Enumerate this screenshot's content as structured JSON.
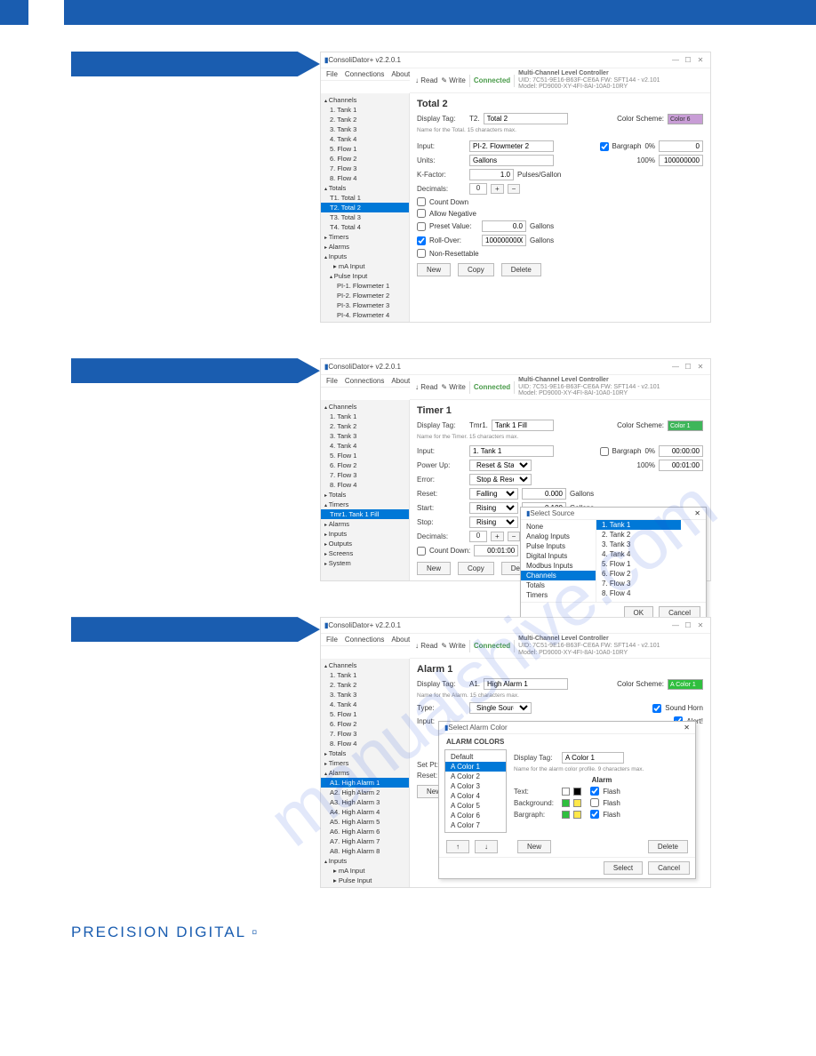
{
  "brand_footer": "PRECISION DIGITAL",
  "watermark": "manualshive.com",
  "screens": [
    {
      "app_title": "ConsoliDator+ v2.2.0.1",
      "menu": [
        "File",
        "Connections",
        "About"
      ],
      "read": "Read",
      "write": "Write",
      "connected": "Connected",
      "device_line1": "Multi-Channel Level Controller",
      "device_line2": "UID: 7C51-9E16-B63F-CE6A    FW: SFT144 - v2.101",
      "device_line3": "Model: PD9000-XY-4FI-8AI-10A0-10RY",
      "sidebar": {
        "channels_label": "Channels",
        "channels": [
          "1. Tank 1",
          "2. Tank 2",
          "3. Tank 3",
          "4. Tank 4",
          "5. Flow 1",
          "6. Flow 2",
          "7. Flow 3",
          "8. Flow 4"
        ],
        "totals_label": "Totals",
        "totals": [
          "T1. Total 1",
          "T2. Total 2",
          "T3. Total 3",
          "T4. Total 4"
        ],
        "totals_sel": 1,
        "timers_label": "Timers",
        "alarms_label": "Alarms",
        "inputs_label": "Inputs",
        "ma_label": "mA Input",
        "pulse_label": "Pulse Input",
        "pulse": [
          "PI-1. Flowmeter 1",
          "PI-2. Flowmeter 2",
          "PI-3. Flowmeter 3",
          "PI-4. Flowmeter 4"
        ]
      },
      "form": {
        "title": "Total 2",
        "display_tag": "Display Tag:",
        "short": "T2.",
        "tagval": "Total 2",
        "note": "Name for the Total. 15 characters max.",
        "colorscheme": "Color Scheme:",
        "colorname": "Color 6",
        "input": "Input:",
        "input_val": "PI-2. Flowmeter 2",
        "bargraph": "Bargraph",
        "bg_lo": "0%",
        "bg_lo_v": "0",
        "bg_hi": "100%",
        "bg_hi_v": "100000000",
        "units": "Units:",
        "units_val": "Gallons",
        "kfactor": "K-Factor:",
        "kfactor_val": "1.0",
        "kfactor_unit": "Pulses/Gallon",
        "decimals": "Decimals:",
        "decimals_val": "0",
        "countdown": "Count Down",
        "allowneg": "Allow Negative",
        "presetv": "Preset Value:",
        "presetv_val": "0.0",
        "presetv_unit": "Gallons",
        "rollover": "Roll-Over:",
        "rollover_val": "1000000000.0",
        "rollover_unit": "Gallons",
        "nonreset": "Non-Resettable",
        "new": "New",
        "copy": "Copy",
        "delete": "Delete"
      }
    },
    {
      "app_title": "ConsoliDator+ v2.2.0.1",
      "menu": [
        "File",
        "Connections",
        "About"
      ],
      "read": "Read",
      "write": "Write",
      "connected": "Connected",
      "device_line1": "Multi-Channel Level Controller",
      "device_line2": "UID: 7C51-9E16-B63F-CE6A    FW: SFT144 - v2.101",
      "device_line3": "Model: PD9000-XY-4FI-8AI-10A0-10RY",
      "sidebar": {
        "channels_label": "Channels",
        "channels": [
          "1. Tank 1",
          "2. Tank 2",
          "3. Tank 3",
          "4. Tank 4",
          "5. Flow 1",
          "6. Flow 2",
          "7. Flow 3",
          "8. Flow 4"
        ],
        "totals_label": "Totals",
        "timers_label": "Timers",
        "timers": [
          "Tmr1. Tank 1 Fill"
        ],
        "timers_sel": 0,
        "alarms_label": "Alarms",
        "inputs_label": "Inputs",
        "outputs_label": "Outputs",
        "screens_label": "Screens",
        "system_label": "System"
      },
      "form": {
        "title": "Timer 1",
        "display_tag": "Display Tag:",
        "short": "Tmr1.",
        "tagval": "Tank 1 Fill",
        "note": "Name for the Timer. 15 characters max.",
        "colorscheme": "Color Scheme:",
        "colorname": "Color 1",
        "input": "Input:",
        "input_val": "1. Tank 1",
        "bargraph": "Bargraph",
        "bg_lo": "0%",
        "bg_lo_v": "00:00:00",
        "bg_hi": "100%",
        "bg_hi_v": "00:01:00",
        "powerup": "Power Up:",
        "powerup_val": "Reset & Start",
        "error": "Error:",
        "error_val": "Stop & Reset",
        "reset": "Reset:",
        "reset_mode": "Falling",
        "reset_val": "0.000",
        "reset_unit": "Gallons",
        "start": "Start:",
        "start_mode": "Rising",
        "start_val": "0.100",
        "start_unit": "Gallons",
        "stop": "Stop:",
        "stop_mode": "Rising",
        "decimals": "Decimals:",
        "decimals_val": "0",
        "countdown": "Count Down:",
        "countdown_val": "00:01:00",
        "new": "New",
        "copy": "Copy",
        "delete": "Del"
      },
      "popup": {
        "title": "Select Source",
        "col1": [
          "None",
          "Analog Inputs",
          "Pulse Inputs",
          "Digital Inputs",
          "Modbus Inputs",
          "Channels",
          "Totals",
          "Timers"
        ],
        "col1_sel": 5,
        "col2": [
          "1. Tank 1",
          "2. Tank 2",
          "3. Tank 3",
          "4. Tank 4",
          "5. Flow 1",
          "6. Flow 2",
          "7. Flow 3",
          "8. Flow 4"
        ],
        "col2_sel": 0,
        "ok": "OK",
        "cancel": "Cancel"
      }
    },
    {
      "app_title": "ConsoliDator+ v2.2.0.1",
      "menu": [
        "File",
        "Connections",
        "About"
      ],
      "read": "Read",
      "write": "Write",
      "connected": "Connected",
      "device_line1": "Multi-Channel Level Controller",
      "device_line2": "UID: 7C51-9E16-B63F-CE6A    FW: SFT144 - v2.101",
      "device_line3": "Model: PD9000-XY-4FI-8AI-10A0-10RY",
      "sidebar": {
        "channels_label": "Channels",
        "channels": [
          "1. Tank 1",
          "2. Tank 2",
          "3. Tank 3",
          "4. Tank 4",
          "5. Flow 1",
          "6. Flow 2",
          "7. Flow 3",
          "8. Flow 4"
        ],
        "totals_label": "Totals",
        "timers_label": "Timers",
        "alarms_label": "Alarms",
        "alarms": [
          "A1. High Alarm 1",
          "A2. High Alarm 2",
          "A3. High Alarm 3",
          "A4. High Alarm 4",
          "A5. High Alarm 5",
          "A6. High Alarm 6",
          "A7. High Alarm 7",
          "A8. High Alarm 8"
        ],
        "alarms_sel": 0,
        "inputs_label": "Inputs",
        "ma_label": "mA Input",
        "pulse_label": "Pulse Input"
      },
      "form": {
        "title": "Alarm 1",
        "display_tag": "Display Tag:",
        "short": "A1.",
        "tagval": "High Alarm 1",
        "note": "Name for the Alarm. 15 characters max.",
        "colorscheme": "Color Scheme:",
        "colorname": "A Color 1",
        "type": "Type:",
        "type_val": "Single Source",
        "soundhorn": "Sound Horn",
        "alert": "Alert!",
        "input": "Input:",
        "setpt": "Set Pt:",
        "reset": "Reset:",
        "new": "New"
      },
      "popup": {
        "title": "Select Alarm Color",
        "heading": "ALARM COLORS",
        "list": [
          "Default",
          "A Color 1",
          "A Color 2",
          "A Color 3",
          "A Color 4",
          "A Color 5",
          "A Color 6",
          "A Color 7"
        ],
        "list_sel": 1,
        "display_tag": "Display Tag:",
        "display_tag_val": "A Color 1",
        "note": "Name for the alarm color profile. 9 characters max.",
        "alarm": "Alarm",
        "text": "Text:",
        "background": "Background:",
        "bargraphc": "Bargraph:",
        "flash": "Flash",
        "up": "↑",
        "down": "↓",
        "new": "New",
        "delete": "Delete",
        "select": "Select",
        "cancel": "Cancel"
      }
    }
  ]
}
